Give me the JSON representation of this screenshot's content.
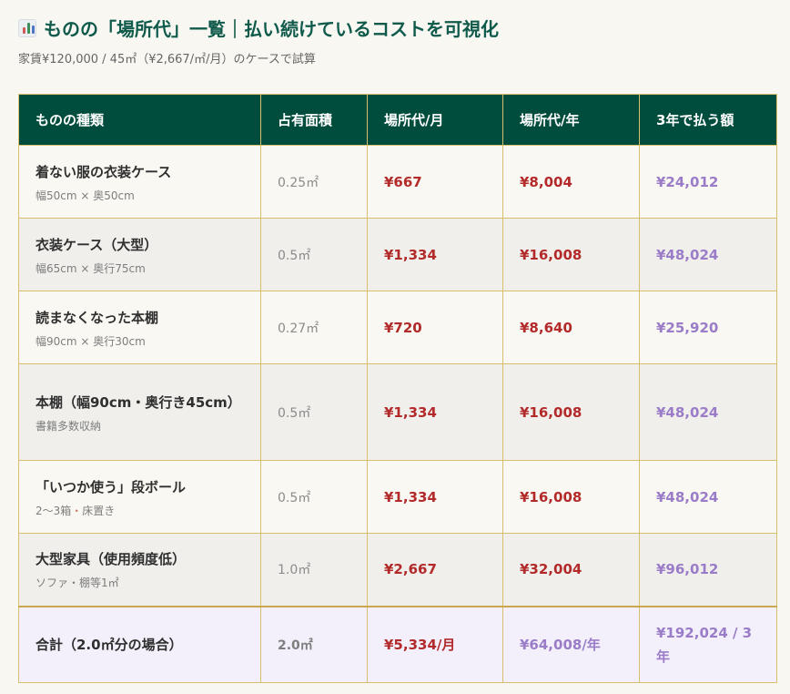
{
  "header": {
    "icon": "bar-chart-icon",
    "title": "ものの「場所代」一覧｜払い続けているコストを可視化",
    "subtitle": "家賃¥120,000 / 45㎡（¥2,667/㎡/月）のケースで試算"
  },
  "table": {
    "columns": [
      "ものの種類",
      "占有面積",
      "場所代/月",
      "場所代/年",
      "3年で払う額"
    ],
    "rows": [
      {
        "name": "着ない服の衣装ケース",
        "note": "幅50cm × 奥50cm",
        "area": "0.25㎡",
        "monthly": "¥667",
        "yearly": "¥8,004",
        "three_years": "¥24,012"
      },
      {
        "name": "衣装ケース（大型）",
        "note": "幅65cm × 奥行75cm",
        "area": "0.5㎡",
        "monthly": "¥1,334",
        "yearly": "¥16,008",
        "three_years": "¥48,024"
      },
      {
        "name": "読まなくなった本棚",
        "note": "幅90cm × 奥行30cm",
        "area": "0.27㎡",
        "monthly": "¥720",
        "yearly": "¥8,640",
        "three_years": "¥25,920"
      },
      {
        "name": "本棚（幅90cm・奥行き45cm）",
        "note": "書籍多数収納",
        "area": "0.5㎡",
        "monthly": "¥1,334",
        "yearly": "¥16,008",
        "three_years": "¥48,024"
      },
      {
        "name": "「いつか使う」段ボール",
        "note_part1": "2〜3箱",
        "note_sep": "・",
        "note_part2": "床置き",
        "area": "0.5㎡",
        "monthly": "¥1,334",
        "yearly": "¥16,008",
        "three_years": "¥48,024"
      },
      {
        "name": "大型家具（使用頻度低）",
        "note": "ソファ・棚等1㎡",
        "area": "1.0㎡",
        "monthly": "¥2,667",
        "yearly": "¥32,004",
        "three_years": "¥96,012"
      }
    ],
    "total": {
      "name": "合計（2.0㎡分の場合）",
      "area": "2.0㎡",
      "monthly": "¥5,334/月",
      "yearly": "¥64,008/年",
      "three_years": "¥192,024 / 3年"
    }
  },
  "colors": {
    "title": "#0f5a4b",
    "header_bg": "#004d3d",
    "border": "#d7bf6d",
    "monthly_yearly": "#b22a2a",
    "three_years": "#9a7cc8"
  }
}
